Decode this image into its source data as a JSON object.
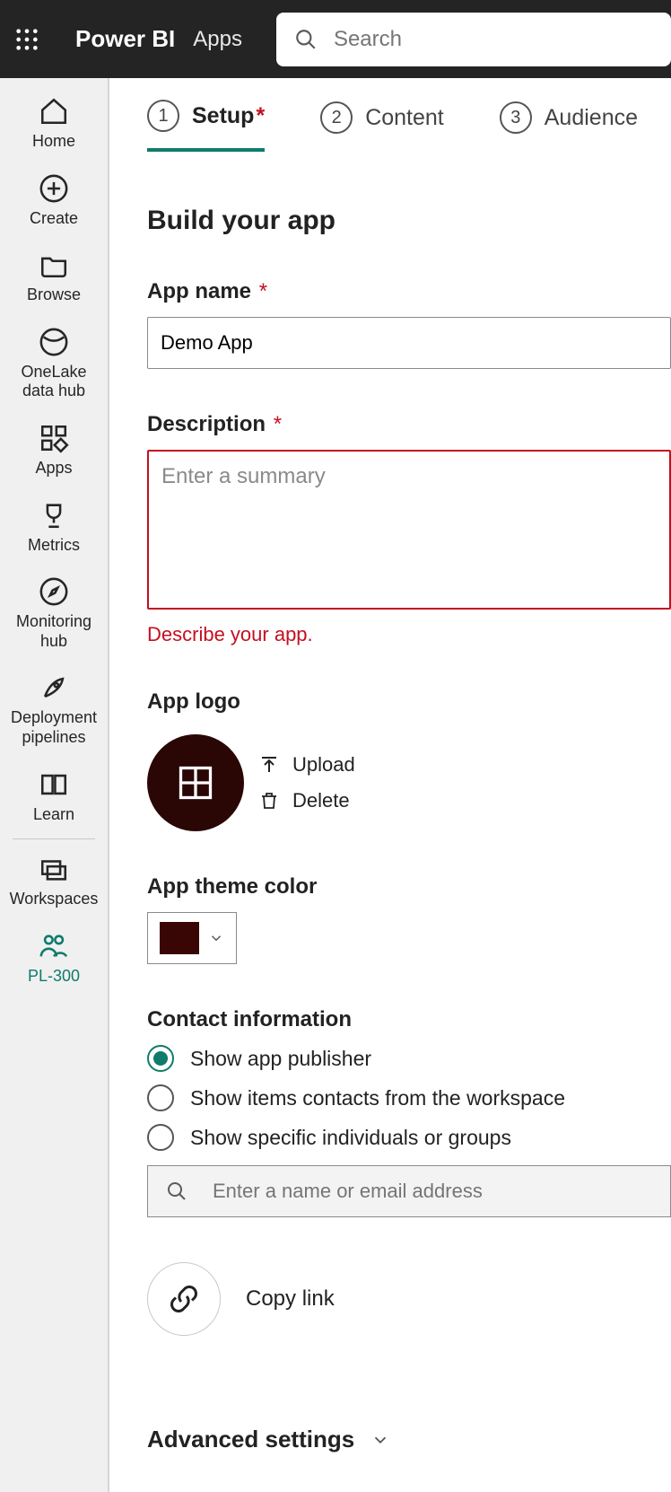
{
  "topbar": {
    "brand": "Power BI",
    "section": "Apps",
    "search_placeholder": "Search"
  },
  "nav": {
    "items": [
      {
        "id": "home",
        "label": "Home"
      },
      {
        "id": "create",
        "label": "Create"
      },
      {
        "id": "browse",
        "label": "Browse"
      },
      {
        "id": "onelake",
        "label": "OneLake data hub"
      },
      {
        "id": "apps",
        "label": "Apps"
      },
      {
        "id": "metrics",
        "label": "Metrics"
      },
      {
        "id": "monitoring",
        "label": "Monitoring hub"
      },
      {
        "id": "deployment",
        "label": "Deployment pipelines"
      },
      {
        "id": "learn",
        "label": "Learn"
      },
      {
        "id": "workspaces",
        "label": "Workspaces"
      },
      {
        "id": "pl300",
        "label": "PL-300"
      }
    ]
  },
  "tabs": [
    {
      "label": "Setup",
      "required": true,
      "active": true
    },
    {
      "label": "Content",
      "required": false,
      "active": false
    },
    {
      "label": "Audience",
      "required": false,
      "active": false
    }
  ],
  "page_title": "Build your app",
  "app_name": {
    "label": "App name",
    "value": "Demo App"
  },
  "description": {
    "label": "Description",
    "placeholder": "Enter a summary",
    "value": "",
    "error": "Describe your app."
  },
  "app_logo": {
    "label": "App logo",
    "upload": "Upload",
    "delete": "Delete"
  },
  "theme": {
    "label": "App theme color",
    "color": "#3a0605"
  },
  "contact": {
    "label": "Contact information",
    "options": [
      "Show app publisher",
      "Show items contacts from the workspace",
      "Show specific individuals or groups"
    ],
    "selected": 0,
    "search_placeholder": "Enter a name or email address"
  },
  "copy_link": "Copy link",
  "advanced": "Advanced settings"
}
